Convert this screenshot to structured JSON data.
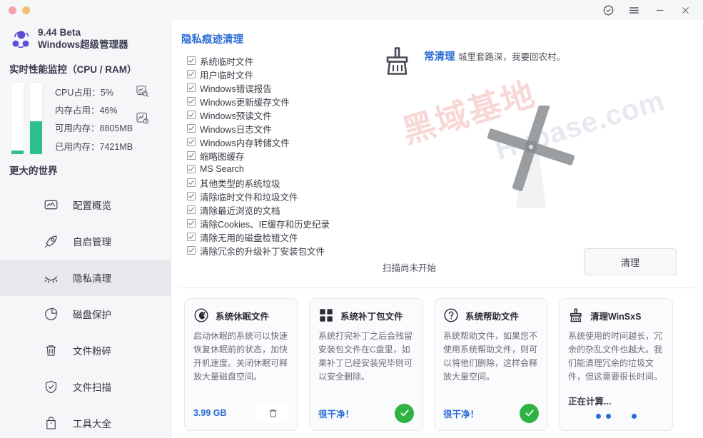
{
  "titlebar": {
    "window_dots": [
      "close-dot",
      "minimize-dot"
    ],
    "actions": [
      {
        "name": "verified-badge-icon",
        "label": ""
      },
      {
        "name": "menu-icon",
        "label": ""
      },
      {
        "name": "minimize-icon",
        "label": ""
      },
      {
        "name": "close-icon",
        "label": ""
      }
    ]
  },
  "sidebar": {
    "brand": {
      "version": "9.44 Beta",
      "name": "Windows超级管理器",
      "logo_color": "#5b4fd6"
    },
    "perf": {
      "title": "实时性能监控（CPU / RAM）",
      "bars": [
        {
          "name": "cpu-bar",
          "percent": 5
        },
        {
          "name": "ram-bar",
          "percent": 46
        }
      ],
      "stats": [
        "CPU占用：5%",
        "内存占用：46%",
        "可用内存：8805MB",
        "已用内存：7421MB"
      ],
      "icons": [
        {
          "name": "performance-report-icon"
        },
        {
          "name": "performance-chart-icon"
        }
      ],
      "fill_color": "#2ec08c"
    },
    "world_label": "更大的世界",
    "items": [
      {
        "label": "配置概览",
        "icon": "monitor-chart-icon",
        "active": false
      },
      {
        "label": "自启管理",
        "icon": "rocket-icon",
        "active": false
      },
      {
        "label": "隐私清理",
        "icon": "eye-closed-icon",
        "active": true
      },
      {
        "label": "磁盘保护",
        "icon": "pie-chart-icon",
        "active": false
      },
      {
        "label": "文件粉碎",
        "icon": "trash-icon",
        "active": false
      },
      {
        "label": "文件扫描",
        "icon": "shield-check-icon",
        "active": false
      },
      {
        "label": "工具大全",
        "icon": "bag-icon",
        "active": false
      }
    ]
  },
  "main": {
    "page_title": "隐私痕迹清理",
    "title_color": "#2b6cd4",
    "watermark": {
      "line1": "黑域基地",
      "line2": "Hybase.com"
    },
    "checklist": [
      {
        "label": "系统临时文件",
        "checked": true
      },
      {
        "label": "用户临时文件",
        "checked": true
      },
      {
        "label": "Windows错误报告",
        "checked": true
      },
      {
        "label": "Windows更新缓存文件",
        "checked": true
      },
      {
        "label": "Windows预读文件",
        "checked": true
      },
      {
        "label": "Windows日志文件",
        "checked": true
      },
      {
        "label": "Windows内存转储文件",
        "checked": true
      },
      {
        "label": "缩略图缓存",
        "checked": true
      },
      {
        "label": "MS Search",
        "checked": true
      },
      {
        "label": "其他类型的系统垃圾",
        "checked": true
      },
      {
        "label": "清除临时文件和垃圾文件",
        "checked": true
      },
      {
        "label": "清除最近浏览的文档",
        "checked": true
      },
      {
        "label": "清除Cookies、IE缓存和历史纪录",
        "checked": true
      },
      {
        "label": "清除无用的磁盘检错文件",
        "checked": true
      },
      {
        "label": "清除冗余的升级补丁安装包文件",
        "checked": true
      }
    ],
    "clean_panel": {
      "icon": "broom-icon",
      "title": "常清理",
      "subtitle": "城里套路深，我要回农村。",
      "illustration": "windmill-icon"
    },
    "scan_status": "扫描尚未开始",
    "clean_button": "清理",
    "cards": [
      {
        "icon": "moon-sleep-icon",
        "title": "系统休眠文件",
        "desc": "启动休眠的系统可以快速恢复休眠前的状态，加快开机速度。关闭休眠可释放大量磁盘空间。",
        "value": "3.99 GB",
        "action": "delete-button",
        "state": "has-size"
      },
      {
        "icon": "windows-squares-icon",
        "title": "系统补丁包文件",
        "desc": "系统打完补丁之后会残留安装包文件在C盘里，如果补丁已经安装完毕则可以安全删除。",
        "value": "很干净！",
        "action": "ok-badge",
        "state": "clean"
      },
      {
        "icon": "question-circle-icon",
        "title": "系统帮助文件",
        "desc": "系统帮助文件，如果您不使用系统帮助文件，则可以将他们删除，这样会释放大量空间。",
        "value": "很干净！",
        "action": "ok-badge",
        "state": "clean"
      },
      {
        "icon": "broom-small-icon",
        "title": "清理WinSxS",
        "desc": "系统使用的时间越长，冗余的杂乱文件也越大。我们能清理冗余的垃圾文件，但这需要很长时间。",
        "value": "正在计算...",
        "action": "loading-dots",
        "state": "calculating"
      }
    ]
  }
}
